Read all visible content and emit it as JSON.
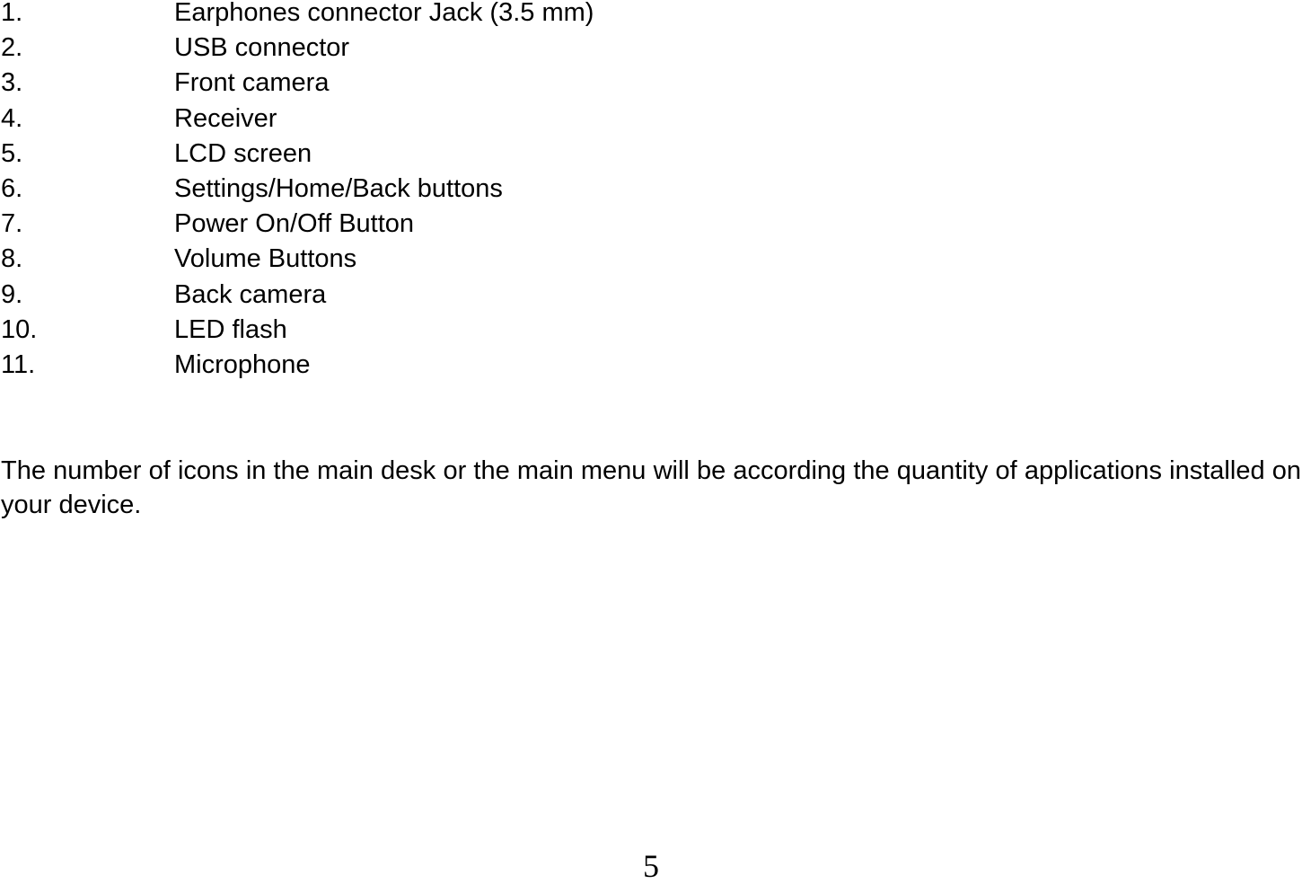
{
  "components_list": [
    {
      "number": "1.",
      "label": "Earphones connector Jack (3.5 mm)"
    },
    {
      "number": "2.",
      "label": "USB connector"
    },
    {
      "number": "3.",
      "label": "Front camera"
    },
    {
      "number": "4.",
      "label": "Receiver"
    },
    {
      "number": "5.",
      "label": "LCD screen"
    },
    {
      "number": "6.",
      "label": "Settings/Home/Back buttons"
    },
    {
      "number": "7.",
      "label": "Power On/Off Button"
    },
    {
      "number": "8.",
      "label": "Volume Buttons"
    },
    {
      "number": "9.",
      "label": "Back camera"
    },
    {
      "number": "10.",
      "label": "LED flash"
    },
    {
      "number": "11.",
      "label": "Microphone"
    }
  ],
  "paragraph": "The number of icons in the main desk or the main menu will be according the quantity of applications installed on your device.",
  "page_number": "5"
}
